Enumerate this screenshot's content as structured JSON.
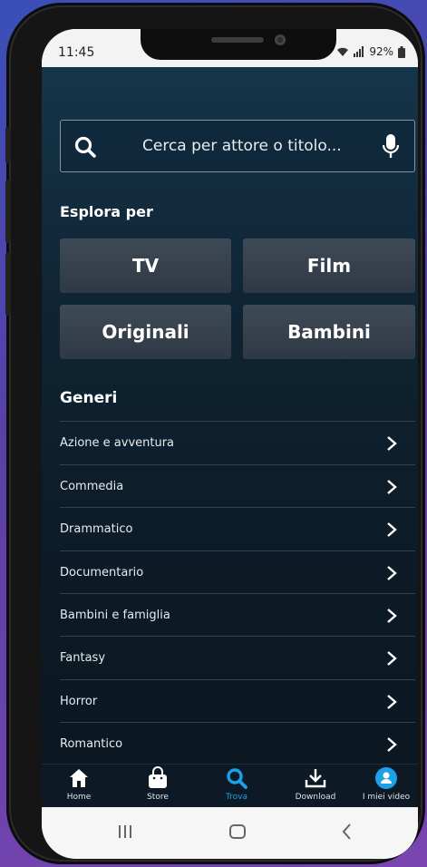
{
  "status": {
    "time": "11:45",
    "battery": "92%"
  },
  "search": {
    "placeholder": "Cerca per attore o titolo..."
  },
  "explore": {
    "title": "Esplora per",
    "tiles": [
      "TV",
      "Film",
      "Originali",
      "Bambini"
    ]
  },
  "genres": {
    "title": "Generi",
    "items": [
      "Azione e avventura",
      "Commedia",
      "Drammatico",
      "Documentario",
      "Bambini e famiglia",
      "Fantasy",
      "Horror",
      "Romantico"
    ]
  },
  "tabs": [
    {
      "label": "Home",
      "icon": "home-icon"
    },
    {
      "label": "Store",
      "icon": "shopping-bag-icon"
    },
    {
      "label": "Trova",
      "icon": "search-icon",
      "active": true
    },
    {
      "label": "Download",
      "icon": "download-icon"
    },
    {
      "label": "I miei video",
      "icon": "profile-icon"
    }
  ],
  "colors": {
    "accent": "#1aa1e8",
    "background": "#0f2433"
  }
}
